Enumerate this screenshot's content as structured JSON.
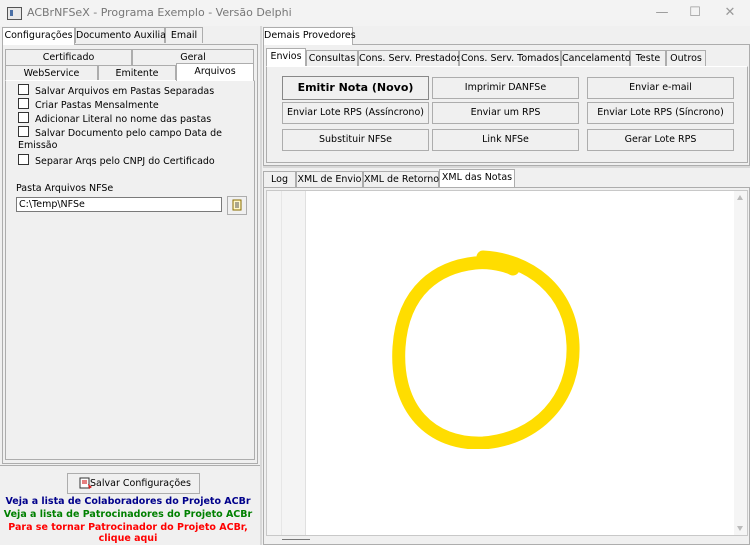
{
  "window": {
    "title": "ACBrNFSeX - Programa Exemplo - Versão Delphi",
    "controls": {
      "minimize": "—",
      "maximize": "☐",
      "close": "✕"
    }
  },
  "left": {
    "top_tabs": [
      "Configurações",
      "Documento Auxiliar",
      "Email"
    ],
    "sub_tabs_row1": [
      "Certificado",
      "Geral"
    ],
    "sub_tabs_row2": [
      "WebService",
      "Emitente",
      "Arquivos"
    ],
    "checkboxes": [
      "Salvar Arquivos em Pastas Separadas",
      "Criar Pastas Mensalmente",
      "Adicionar Literal no nome das pastas",
      "Salvar Documento pelo campo Data de Emissão",
      "Separar Arqs pelo CNPJ do Certificado"
    ],
    "pasta_label": "Pasta Arquivos NFSe",
    "pasta_value": "C:\\Temp\\NFSe",
    "save_button": "Salvar Configurações",
    "links": {
      "colaboradores": "Veja a lista de Colaboradores do Projeto ACBr",
      "patrocinadores": "Veja a lista de Patrocinadores do Projeto ACBr",
      "patrocinador_line1": "Para se tornar Patrocinador do Projeto ACBr,",
      "patrocinador_line2": "clique aqui"
    }
  },
  "right": {
    "provider_tab": "Demais Provedores",
    "tabs": [
      "Envios",
      "Consultas",
      "Cons. Serv. Prestados",
      "Cons. Serv. Tomados",
      "Cancelamento",
      "Teste",
      "Outros"
    ],
    "buttons": [
      "Emitir Nota (Novo)",
      "Imprimir DANFSe",
      "Enviar e-mail",
      "Enviar Lote RPS (Assíncrono)",
      "Enviar um RPS",
      "Enviar Lote RPS (Síncrono)",
      "Substituir NFSe",
      "Link NFSe",
      "Gerar Lote RPS"
    ],
    "output_tabs": [
      "Log",
      "XML de Envio",
      "XML de Retorno",
      "XML das Notas"
    ]
  },
  "colors": {
    "link_blue": "#00008b",
    "link_green": "#008000",
    "link_red": "#ff0000",
    "circle_yellow": "#ffdd00"
  }
}
